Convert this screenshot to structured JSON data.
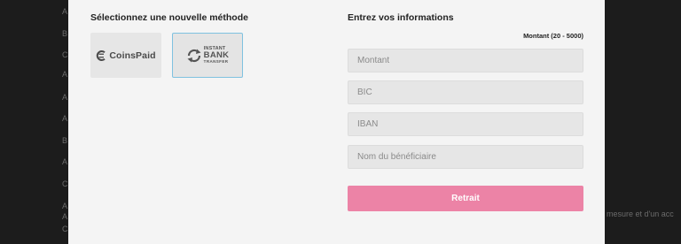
{
  "background": {
    "left_letters": [
      "A",
      "B",
      "C",
      "A",
      "A",
      "A",
      "B",
      "A",
      "C",
      "A",
      "A",
      "C"
    ],
    "right_fragment": "mesure et d'un acc"
  },
  "methods": {
    "title": "Sélectionnez une nouvelle méthode",
    "items": [
      {
        "id": "coinspaid",
        "label": "CoinsPaid",
        "selected": false
      },
      {
        "id": "instant-bank-transfer",
        "line1": "INSTANT",
        "line2": "BANK",
        "line3": "TRANSFER",
        "selected": true
      }
    ]
  },
  "form": {
    "title": "Entrez vos informations",
    "amount_hint": "Montant (20 - 5000)",
    "fields": [
      {
        "name": "amount",
        "placeholder": "Montant",
        "value": ""
      },
      {
        "name": "bic",
        "placeholder": "BIC",
        "value": ""
      },
      {
        "name": "iban",
        "placeholder": "IBAN",
        "value": ""
      },
      {
        "name": "beneficiary",
        "placeholder": "Nom du bénéficiaire",
        "value": ""
      }
    ],
    "submit_label": "Retrait"
  },
  "colors": {
    "accent": "#ec83a6",
    "selected_border": "#7fc2e0",
    "modal_bg": "#f4f4f4",
    "overlay_bg": "#1c1c1c"
  }
}
